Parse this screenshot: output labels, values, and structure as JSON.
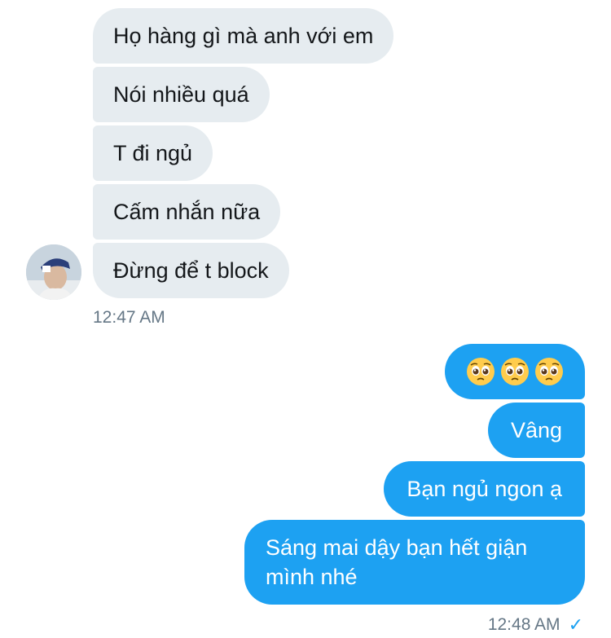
{
  "conversation": {
    "incoming_messages": [
      "Họ hàng gì mà anh với em",
      "Nói nhiều quá",
      "T đi ngủ",
      "Cấm nhắn nữa",
      "Đừng để t block"
    ],
    "incoming_time": "12:47 AM",
    "outgoing_emoji": [
      "pleading-face",
      "pleading-face",
      "pleading-face"
    ],
    "outgoing_messages": [
      "Vâng",
      "Bạn ngủ ngon ạ",
      "Sáng mai dậy bạn hết giận mình nhé"
    ],
    "outgoing_time": "12:48 AM",
    "outgoing_status": "✓"
  },
  "colors": {
    "incoming_bubble": "#e6ecf0",
    "outgoing_bubble": "#1da1f2",
    "timestamp": "#657786"
  }
}
